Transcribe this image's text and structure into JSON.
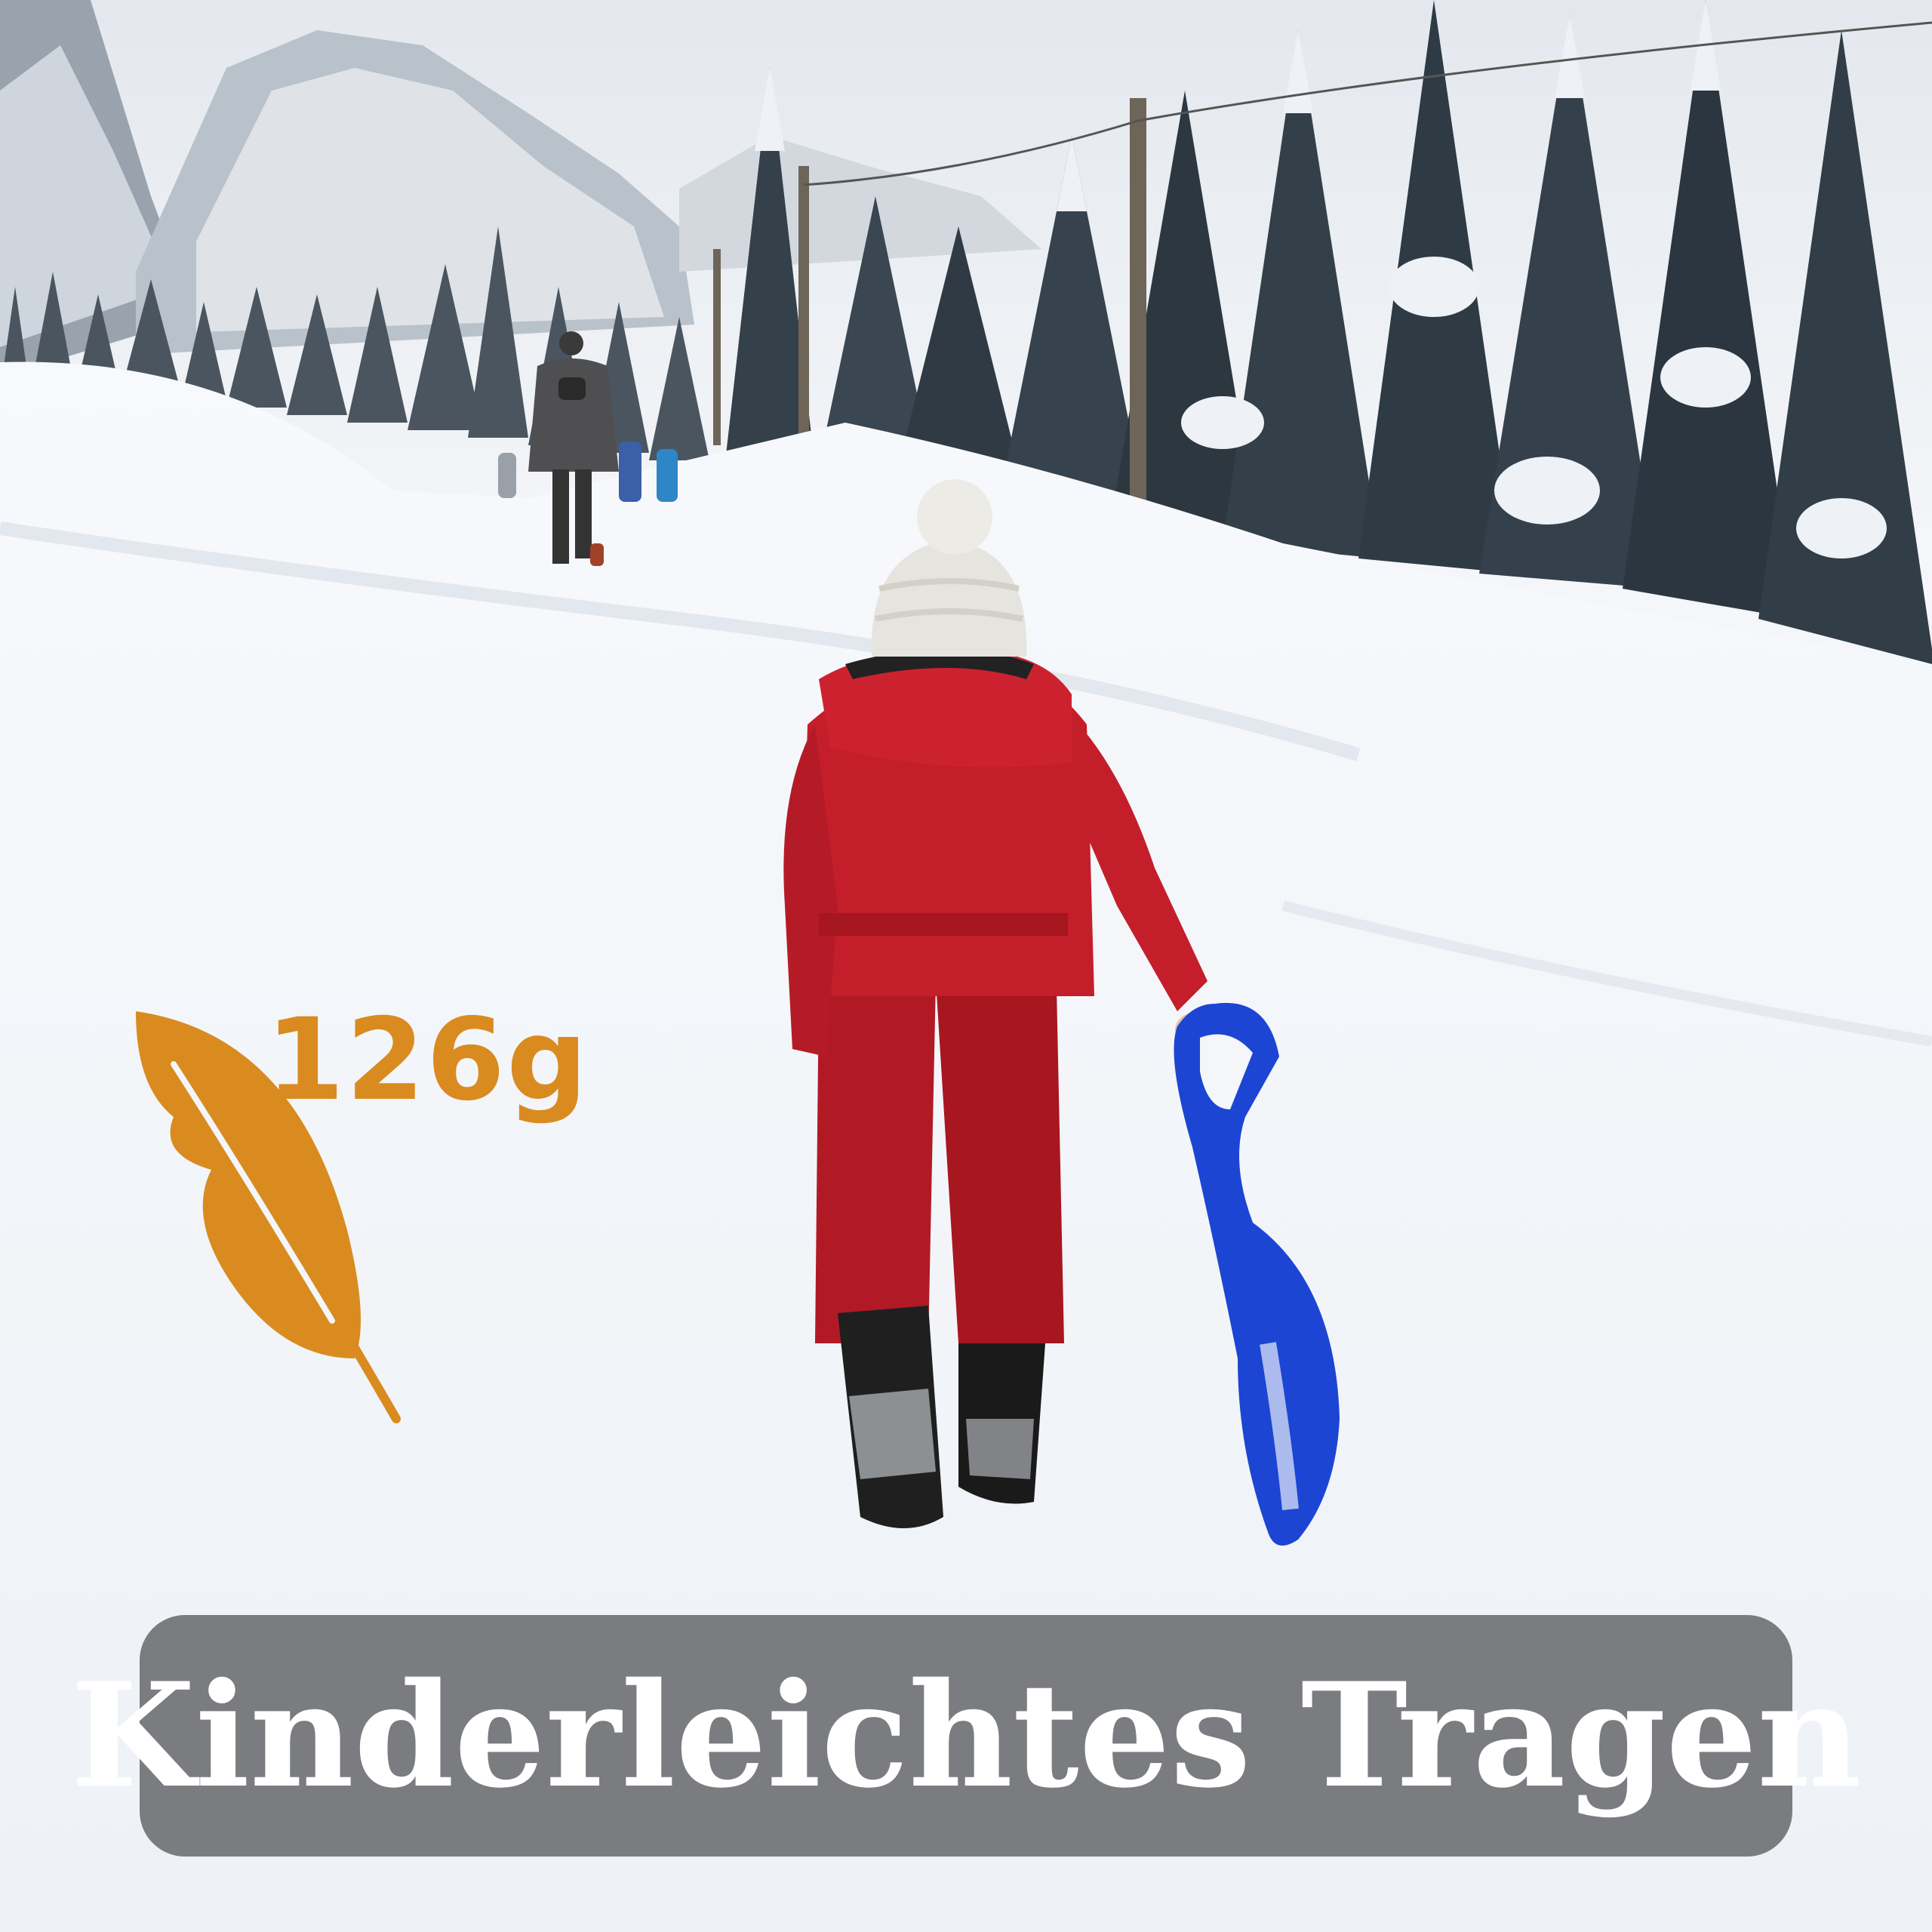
{
  "badge": {
    "icon": "feather-icon",
    "weight_text": "126g"
  },
  "caption": {
    "text": "Kinderleichtes Tragen"
  },
  "colors": {
    "accent": "#d98b1f",
    "caption_bg": "#7b7c80",
    "snow": "#f5f7fa",
    "suit": "#c41e2a",
    "sled": "#1c45d4"
  },
  "scene": {
    "subjects": [
      "child-in-red-snowsuit",
      "blue-sled",
      "adult-walking",
      "snowy-fir-trees",
      "mountains"
    ]
  }
}
